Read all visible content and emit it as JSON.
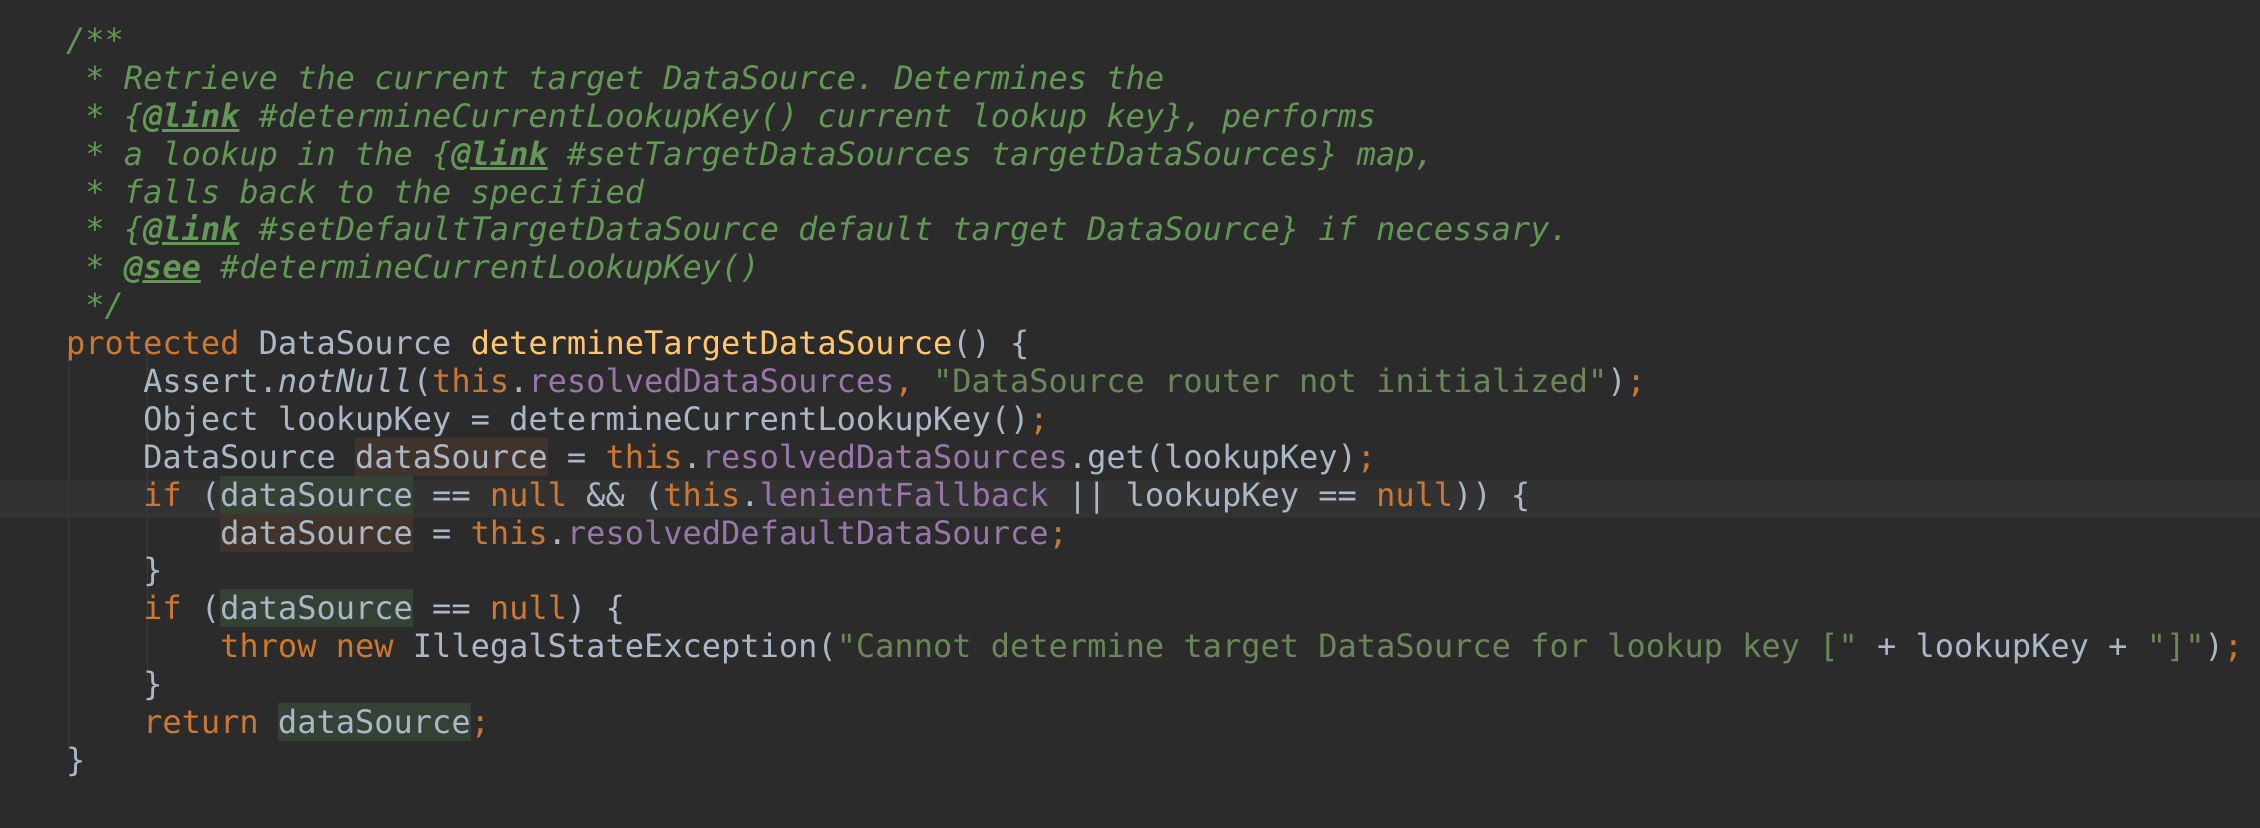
{
  "editor": {
    "language": "Java",
    "background": "#2b2b2b",
    "caret_line": 13,
    "lines": [
      [
        {
          "t": "/**",
          "c": "doc"
        }
      ],
      [
        {
          "t": " * Retrieve the current target DataSource. Determines the",
          "c": "doc"
        }
      ],
      [
        {
          "t": " * {",
          "c": "doc"
        },
        {
          "t": "@link",
          "c": "doctag"
        },
        {
          "t": " #determineCurrentLookupKey() current lookup key}, performs",
          "c": "doc"
        }
      ],
      [
        {
          "t": " * a lookup in the {",
          "c": "doc"
        },
        {
          "t": "@link",
          "c": "doctag"
        },
        {
          "t": " #setTargetDataSources targetDataSources} map,",
          "c": "doc"
        }
      ],
      [
        {
          "t": " * falls back to the specified",
          "c": "doc"
        }
      ],
      [
        {
          "t": " * {",
          "c": "doc"
        },
        {
          "t": "@link",
          "c": "doctag"
        },
        {
          "t": " #setDefaultTargetDataSource default target DataSource} if necessary.",
          "c": "doc"
        }
      ],
      [
        {
          "t": " * ",
          "c": "doc"
        },
        {
          "t": "@see",
          "c": "doctag"
        },
        {
          "t": " #determineCurrentLookupKey()",
          "c": "doc"
        }
      ],
      [
        {
          "t": " */",
          "c": "doc"
        }
      ],
      [
        {
          "t": "protected",
          "c": "kw"
        },
        {
          "t": " DataSource ",
          "c": "plain"
        },
        {
          "t": "determineTargetDataSource",
          "c": "fn"
        },
        {
          "t": "() {",
          "c": "plain"
        }
      ],
      [
        {
          "t": "    Assert.",
          "c": "plain"
        },
        {
          "t": "notNull",
          "c": "sm"
        },
        {
          "t": "(",
          "c": "plain"
        },
        {
          "t": "this",
          "c": "kw"
        },
        {
          "t": ".",
          "c": "plain"
        },
        {
          "t": "resolvedDataSources",
          "c": "fld"
        },
        {
          "t": ", ",
          "c": "kw"
        },
        {
          "t": "\"DataSource router not initialized\"",
          "c": "str"
        },
        {
          "t": ")",
          "c": "plain"
        },
        {
          "t": ";",
          "c": "kw"
        }
      ],
      [
        {
          "t": "    Object lookupKey = determineCurrentLookupKey()",
          "c": "plain"
        },
        {
          "t": ";",
          "c": "kw"
        }
      ],
      [
        {
          "t": "    DataSource ",
          "c": "plain"
        },
        {
          "t": "dataSource",
          "c": "hl-write"
        },
        {
          "t": " = ",
          "c": "plain"
        },
        {
          "t": "this",
          "c": "kw"
        },
        {
          "t": ".",
          "c": "plain"
        },
        {
          "t": "resolvedDataSources",
          "c": "fld"
        },
        {
          "t": ".get(lookupKey)",
          "c": "plain"
        },
        {
          "t": ";",
          "c": "kw"
        }
      ],
      [
        {
          "t": "    ",
          "c": "plain"
        },
        {
          "t": "if",
          "c": "kw"
        },
        {
          "t": " (",
          "c": "plain"
        },
        {
          "t": "dataSource",
          "c": "hl-read"
        },
        {
          "t": " == ",
          "c": "plain"
        },
        {
          "t": "null",
          "c": "kw"
        },
        {
          "t": " && (",
          "c": "plain"
        },
        {
          "t": "this",
          "c": "kw"
        },
        {
          "t": ".",
          "c": "plain"
        },
        {
          "t": "lenientFallback",
          "c": "fld"
        },
        {
          "t": " || lookupKey == ",
          "c": "plain"
        },
        {
          "t": "null",
          "c": "kw"
        },
        {
          "t": ")) {",
          "c": "plain"
        }
      ],
      [
        {
          "t": "        ",
          "c": "plain"
        },
        {
          "t": "dataSource",
          "c": "hl-write"
        },
        {
          "t": " = ",
          "c": "plain"
        },
        {
          "t": "this",
          "c": "kw"
        },
        {
          "t": ".",
          "c": "plain"
        },
        {
          "t": "resolvedDefaultDataSource",
          "c": "fld"
        },
        {
          "t": ";",
          "c": "kw"
        }
      ],
      [
        {
          "t": "    }",
          "c": "plain"
        }
      ],
      [
        {
          "t": "    ",
          "c": "plain"
        },
        {
          "t": "if",
          "c": "kw"
        },
        {
          "t": " (",
          "c": "plain"
        },
        {
          "t": "dataSource",
          "c": "hl-read"
        },
        {
          "t": " == ",
          "c": "plain"
        },
        {
          "t": "null",
          "c": "kw"
        },
        {
          "t": ") {",
          "c": "plain"
        }
      ],
      [
        {
          "t": "        ",
          "c": "plain"
        },
        {
          "t": "throw new",
          "c": "kw"
        },
        {
          "t": " IllegalStateException(",
          "c": "plain"
        },
        {
          "t": "\"Cannot determine target DataSource for lookup key [\"",
          "c": "str"
        },
        {
          "t": " + lookupKey + ",
          "c": "plain"
        },
        {
          "t": "\"]\"",
          "c": "str"
        },
        {
          "t": ")",
          "c": "plain"
        },
        {
          "t": ";",
          "c": "kw"
        }
      ],
      [
        {
          "t": "    }",
          "c": "plain"
        }
      ],
      [
        {
          "t": "    ",
          "c": "plain"
        },
        {
          "t": "return",
          "c": "kw"
        },
        {
          "t": " ",
          "c": "plain"
        },
        {
          "t": "dataSource",
          "c": "hl-read"
        },
        {
          "t": ";",
          "c": "kw"
        }
      ],
      [
        {
          "t": "}",
          "c": "plain"
        }
      ]
    ]
  }
}
